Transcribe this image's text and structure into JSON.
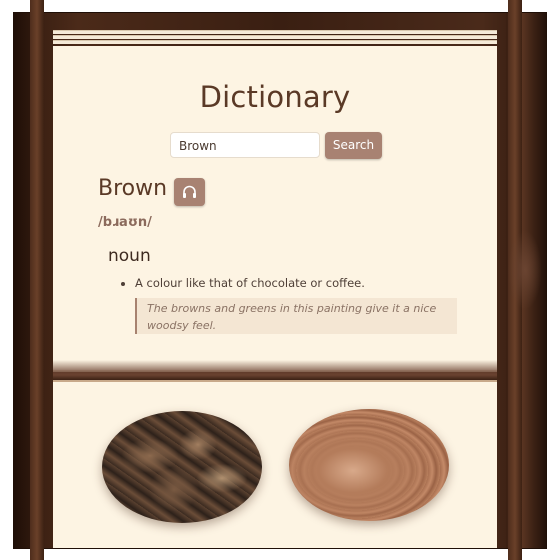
{
  "app": {
    "title": "Dictionary"
  },
  "search": {
    "value": "Brown",
    "button_label": "Search"
  },
  "entry": {
    "word": "Brown",
    "phonetic": "/bɹaʊn/",
    "part_of_speech": "noun",
    "definition": "A colour like that of chocolate or coffee.",
    "example": "The browns and greens in this painting give it a nice woodsy feel."
  },
  "icons": {
    "audio": "headphones-icon"
  },
  "colors": {
    "accent": "#a88272",
    "frame": "#3a1f12",
    "card": "#fdf4e3",
    "text": "#5a3926"
  },
  "gallery": {
    "images": [
      "leaves-image",
      "wood-grain-image"
    ]
  }
}
